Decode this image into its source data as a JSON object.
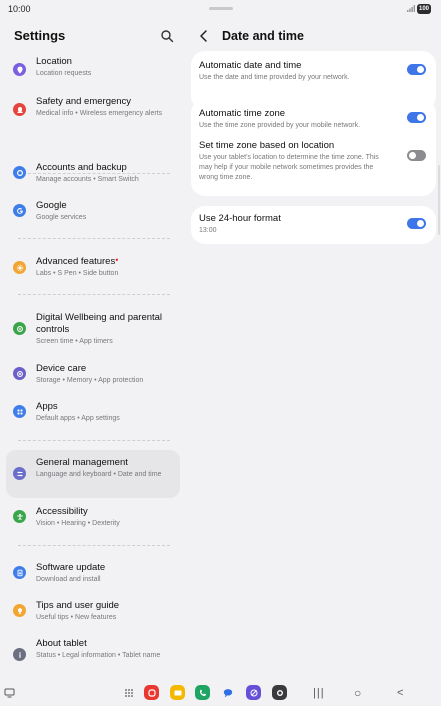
{
  "status": {
    "time": "10:00",
    "battery": "100"
  },
  "left": {
    "title": "Settings",
    "items": [
      {
        "title": "Location",
        "subtitle": "Location requests",
        "icon": "location-icon",
        "color": "#7a5fe0"
      },
      {
        "title": "Safety and emergency",
        "subtitle": "Medical info • Wireless emergency alerts",
        "icon": "alert-icon",
        "color": "#e5453c"
      },
      {
        "title": "Accounts and backup",
        "subtitle": "Manage accounts • Smart Switch",
        "icon": "sync-icon",
        "color": "#3f7de8"
      },
      {
        "title": "Google",
        "subtitle": "Google services",
        "icon": "google-icon",
        "color": "#3f7de8"
      },
      {
        "title": "Advanced features",
        "subtitle": "Labs • S Pen • Side button",
        "icon": "star-icon",
        "color": "#f2a531"
      },
      {
        "title": "Digital Wellbeing and parental controls",
        "subtitle": "Screen time • App timers",
        "icon": "wellbeing-icon",
        "color": "#3aa54a"
      },
      {
        "title": "Device care",
        "subtitle": "Storage • Memory • App protection",
        "icon": "device-care-icon",
        "color": "#6b5fc9"
      },
      {
        "title": "Apps",
        "subtitle": "Default apps • App settings",
        "icon": "apps-icon",
        "color": "#3f7de8"
      },
      {
        "title": "General management",
        "subtitle": "Language and keyboard • Date and time",
        "icon": "sliders-icon",
        "color": "#6b6fc9"
      },
      {
        "title": "Accessibility",
        "subtitle": "Vision • Hearing • Dexterity",
        "icon": "accessibility-icon",
        "color": "#3aa54a"
      },
      {
        "title": "Software update",
        "subtitle": "Download and install",
        "icon": "update-icon",
        "color": "#3f7de8"
      },
      {
        "title": "Tips and user guide",
        "subtitle": "Useful tips • New features",
        "icon": "bulb-icon",
        "color": "#f2a531"
      },
      {
        "title": "About tablet",
        "subtitle": "Status • Legal information • Tablet name",
        "icon": "info-icon",
        "color": "#6b6f80"
      }
    ]
  },
  "right": {
    "title": "Date and time",
    "rows": [
      {
        "title": "Automatic date and time",
        "subtitle": "Use the date and time provided by your network.",
        "on": true
      },
      {
        "title": "Automatic time zone",
        "subtitle": "Use the time zone provided by your mobile network.",
        "on": true
      },
      {
        "title": "Set time zone based on location",
        "subtitle": "Use your tablet's location to determine the time zone. This may help if your mobile network sometimes provides the wrong time zone.",
        "on": false
      },
      {
        "title": "Use 24-hour format",
        "subtitle": "13:00",
        "on": true
      }
    ]
  },
  "dock": {
    "apps": [
      {
        "icon": "app-drawer-icon",
        "color": "transparent"
      },
      {
        "icon": "gallery-icon",
        "color": "#e8382f"
      },
      {
        "icon": "my-files-icon",
        "color": "#f5b800"
      },
      {
        "icon": "phone-icon",
        "color": "#1fa463"
      },
      {
        "icon": "messages-icon",
        "color": "#2f6fe4"
      },
      {
        "icon": "internet-icon",
        "color": "#6750d8"
      },
      {
        "icon": "camera-icon",
        "color": "#3a3a3c"
      }
    ],
    "nav": {
      "recents": "|||",
      "home": "○",
      "back": "<"
    }
  }
}
